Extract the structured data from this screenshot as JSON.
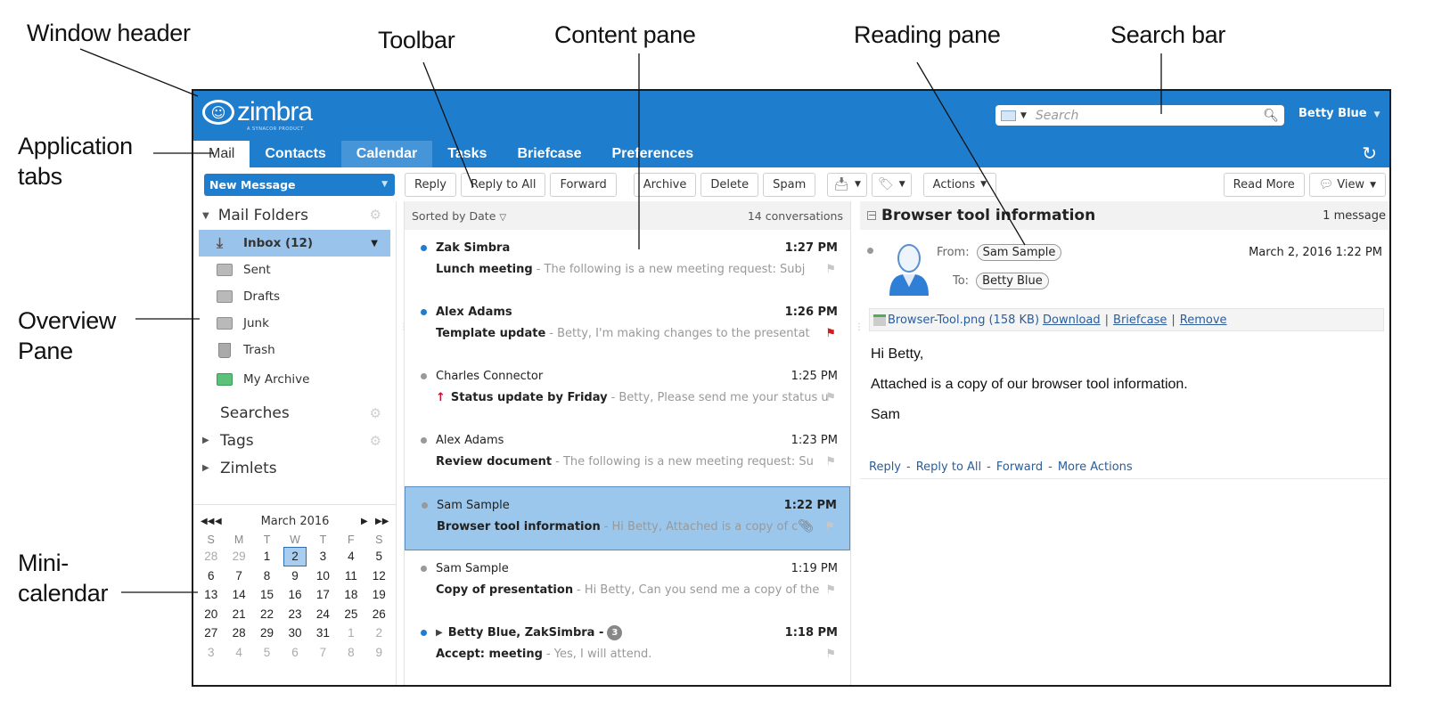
{
  "callouts": {
    "window_header": "Window header",
    "toolbar": "Toolbar",
    "content_pane": "Content pane",
    "reading_pane": "Reading pane",
    "search_bar": "Search bar",
    "application_tabs": "Application\ntabs",
    "overview_pane": "Overview\nPane",
    "mini_calendar": "Mini-\ncalendar"
  },
  "header": {
    "logo_text": "zimbra",
    "logo_subtext": "A SYNACOR PRODUCT",
    "search_placeholder": "Search",
    "user_name": "Betty Blue",
    "colors": {
      "header_bg": "#1f7dce",
      "selection": "#9bc7ec"
    }
  },
  "tabs": [
    {
      "label": "Mail",
      "state": "active"
    },
    {
      "label": "Contacts",
      "state": "normal"
    },
    {
      "label": "Calendar",
      "state": "hover"
    },
    {
      "label": "Tasks",
      "state": "normal"
    },
    {
      "label": "Briefcase",
      "state": "normal"
    },
    {
      "label": "Preferences",
      "state": "normal"
    }
  ],
  "toolbar": {
    "new_message": "New Message",
    "reply": "Reply",
    "reply_all": "Reply to All",
    "forward": "Forward",
    "archive": "Archive",
    "delete": "Delete",
    "spam": "Spam",
    "actions": "Actions",
    "read_more": "Read More",
    "view": "View"
  },
  "overview": {
    "mail_folders": "Mail Folders",
    "folders": [
      {
        "name": "Inbox (12)",
        "icon": "inbox-icon",
        "selected": true
      },
      {
        "name": "Sent",
        "icon": "sent-folder-icon"
      },
      {
        "name": "Drafts",
        "icon": "drafts-folder-icon"
      },
      {
        "name": "Junk",
        "icon": "junk-folder-icon"
      },
      {
        "name": "Trash",
        "icon": "trash-icon"
      },
      {
        "name": "My Archive",
        "icon": "archive-folder-icon"
      }
    ],
    "searches": "Searches",
    "tags": "Tags",
    "zimlets": "Zimlets"
  },
  "mini_calendar": {
    "month": "March 2016",
    "weekdays": [
      "S",
      "M",
      "T",
      "W",
      "T",
      "F",
      "S"
    ],
    "weeks": [
      [
        "28",
        "29",
        "1",
        "2",
        "3",
        "4",
        "5"
      ],
      [
        "6",
        "7",
        "8",
        "9",
        "10",
        "11",
        "12"
      ],
      [
        "13",
        "14",
        "15",
        "16",
        "17",
        "18",
        "19"
      ],
      [
        "20",
        "21",
        "22",
        "23",
        "24",
        "25",
        "26"
      ],
      [
        "27",
        "28",
        "29",
        "30",
        "31",
        "1",
        "2"
      ],
      [
        "3",
        "4",
        "5",
        "6",
        "7",
        "8",
        "9"
      ]
    ],
    "selected_day": "2"
  },
  "content": {
    "sort_label": "Sorted by Date",
    "count_label": "14 conversations",
    "messages": [
      {
        "sender": "Zak Simbra",
        "time": "1:27 PM",
        "subject": "Lunch meeting",
        "fragment": "- The following is a new meeting request: Subj",
        "unread": true,
        "flag": "none"
      },
      {
        "sender": "Alex Adams",
        "time": "1:26 PM",
        "subject": "Template update",
        "fragment": "- Betty, I'm making changes to the presentat",
        "unread": true,
        "flag": "red"
      },
      {
        "sender": "Charles Connector",
        "time": "1:25 PM",
        "subject": "Status update by Friday",
        "fragment": "- Betty, Please send me your status u",
        "unread": false,
        "flag": "none",
        "high_priority": true
      },
      {
        "sender": "Alex Adams",
        "time": "1:23 PM",
        "subject": "Review document",
        "fragment": "- The following is a new meeting request: Su",
        "unread": false,
        "flag": "none"
      },
      {
        "sender": "Sam Sample",
        "time": "1:22 PM",
        "subject": "Browser tool information",
        "fragment": "- Hi Betty, Attached is a copy of c",
        "unread": false,
        "flag": "none",
        "selected": true,
        "attachment": true
      },
      {
        "sender": "Sam Sample",
        "time": "1:19 PM",
        "subject": "Copy of presentation",
        "fragment": "- Hi Betty, Can you send me a copy of the",
        "unread": false,
        "flag": "none"
      },
      {
        "sender": "Betty Blue, ZakSimbra -",
        "time": "1:18 PM",
        "subject": "Accept: meeting",
        "fragment": "- Yes, I will attend.",
        "unread": true,
        "flag": "none",
        "thread_count": "3"
      }
    ]
  },
  "reading": {
    "title": "Browser tool information",
    "message_count": "1 message",
    "from_label": "From:",
    "from": "Sam Sample",
    "to_label": "To:",
    "to": "Betty Blue",
    "date": "March 2, 2016 1:22 PM",
    "attachment": {
      "name": "Browser-Tool.png",
      "size": "(158 KB)",
      "download": "Download",
      "briefcase": "Briefcase",
      "remove": "Remove"
    },
    "body": [
      "Hi Betty,",
      "Attached is a copy of our browser tool information.",
      "Sam"
    ],
    "actions": [
      "Reply",
      "Reply to All",
      "Forward",
      "More Actions"
    ]
  }
}
